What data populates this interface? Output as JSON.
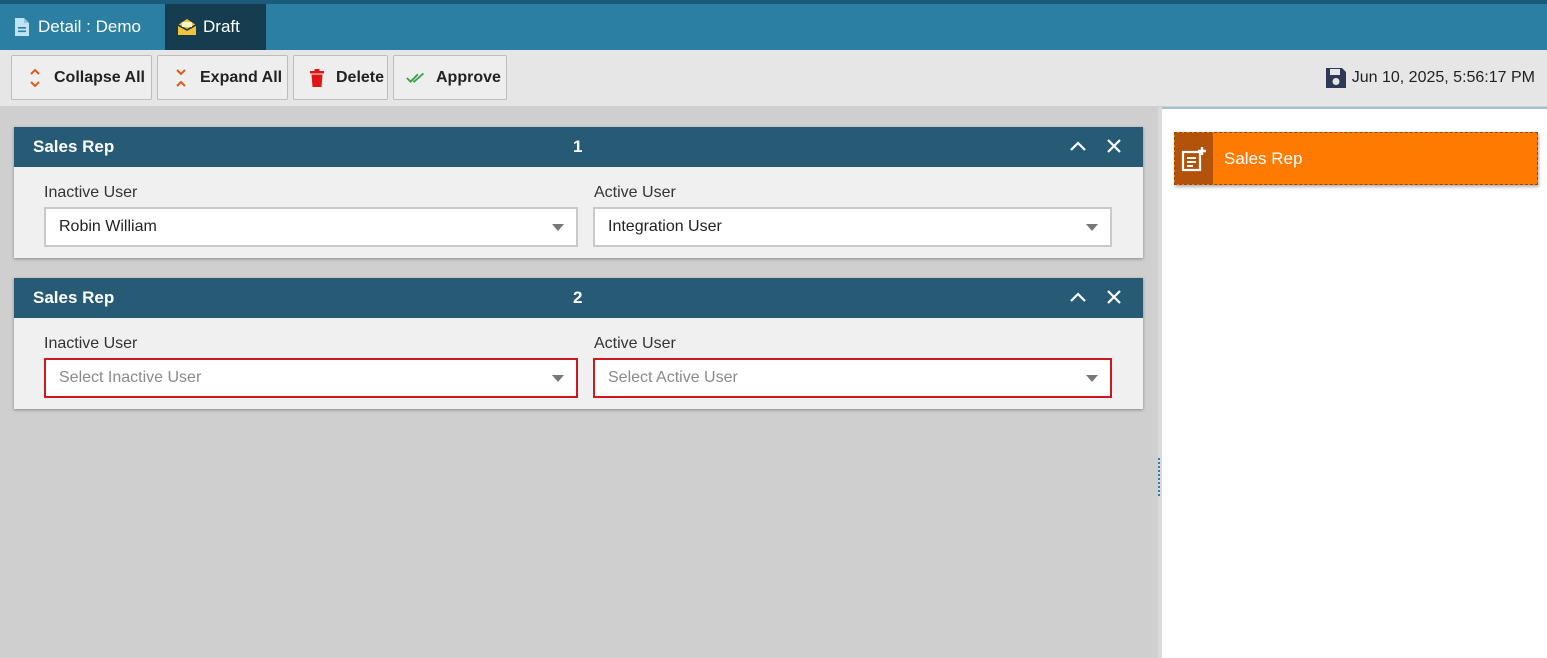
{
  "tabs": [
    {
      "label": "Detail : Demo",
      "icon": "document-icon",
      "active": false
    },
    {
      "label": "Draft",
      "icon": "envelope-open-icon",
      "active": true
    }
  ],
  "toolbar": {
    "collapse_label": "Collapse All",
    "expand_label": "Expand All",
    "delete_label": "Delete",
    "approve_label": "Approve",
    "saved_timestamp": "Jun 10, 2025, 5:56:17 PM"
  },
  "cards": [
    {
      "title": "Sales Rep",
      "number": "1",
      "inactive_label": "Inactive User",
      "inactive_value": "Robin William",
      "active_label": "Active User",
      "active_value": "Integration User"
    },
    {
      "title": "Sales Rep",
      "number": "2",
      "inactive_label": "Inactive User",
      "inactive_placeholder": "Select Inactive User",
      "active_label": "Active User",
      "active_placeholder": "Select Active User"
    }
  ],
  "sidebar": {
    "items": [
      {
        "label": "Sales Rep",
        "icon": "add-note-icon"
      }
    ]
  },
  "colors": {
    "topbar": "#2a7fa3",
    "active_tab": "#163c4f",
    "card_header": "#275b75",
    "accent_orange": "#ff7a00",
    "error_border": "#d0171b"
  }
}
